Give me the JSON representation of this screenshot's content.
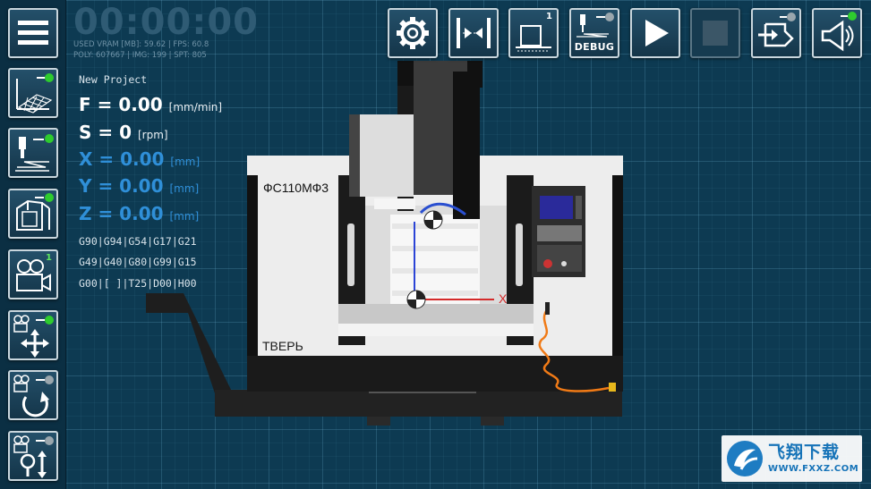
{
  "status": {
    "timer": "00:00:00",
    "stats_line1": "USED VRAM [MB]: 59.62 | FPS: 60.8",
    "stats_line2": "POLY: 607667 | IMG: 199 | SPT: 805"
  },
  "project": {
    "name": "New Project"
  },
  "readout": {
    "feed_label": "F = 0.00",
    "feed_unit": "[mm/min]",
    "spindle_label": "S = 0",
    "spindle_unit": "[rpm]",
    "x_label": "X = 0.00",
    "x_unit": "[mm]",
    "y_label": "Y = 0.00",
    "y_unit": "[mm]",
    "z_label": "Z = 0.00",
    "z_unit": "[mm]"
  },
  "gcode": {
    "line1": "G90|G94|G54|G17|G21",
    "line2": "G49|G40|G80|G99|G15",
    "line3": "G00|[ ]|T25|D00|H00"
  },
  "toolbar": {
    "buttons": [
      {
        "name": "settings-button",
        "icon": "gear-icon"
      },
      {
        "name": "machine-zero-button",
        "icon": "axis-center-icon"
      },
      {
        "name": "workpiece-button",
        "icon": "workpiece-icon",
        "badge": "1"
      },
      {
        "name": "debug-button",
        "icon": "debug-icon",
        "label": "DEBUG"
      },
      {
        "name": "play-button",
        "icon": "play-icon"
      },
      {
        "name": "stop-button",
        "icon": "stop-icon",
        "state": "disabled"
      },
      {
        "name": "import-button",
        "icon": "import-icon"
      },
      {
        "name": "sound-button",
        "icon": "speaker-icon"
      }
    ]
  },
  "sidebar": {
    "buttons": [
      {
        "name": "menu-button",
        "icon": "hamburger-icon"
      },
      {
        "name": "grid-toggle-button",
        "icon": "grid-plane-icon"
      },
      {
        "name": "tool-path-toggle-button",
        "icon": "tool-path-icon"
      },
      {
        "name": "machine-view-toggle-button",
        "icon": "machine-icon"
      },
      {
        "name": "camera-button",
        "icon": "camera-icon",
        "badge": "1"
      },
      {
        "name": "camera-pan-button",
        "icon": "camera-move-icon"
      },
      {
        "name": "camera-rotate-button",
        "icon": "camera-rotate-icon"
      },
      {
        "name": "camera-zoom-button",
        "icon": "camera-zoom-icon"
      }
    ]
  },
  "machine": {
    "model_label": "ФС110МФ3",
    "brand_label": "ТВЕРЬ",
    "axis_label": "X"
  },
  "watermark": {
    "title": "飞翔下载",
    "url": "WWW.FXXZ.COM"
  },
  "colors": {
    "background": "#0d3a52",
    "accent_blue": "#2f8fd8",
    "toggle_green": "#2ecc2e",
    "axis_red": "#d42a2a"
  }
}
